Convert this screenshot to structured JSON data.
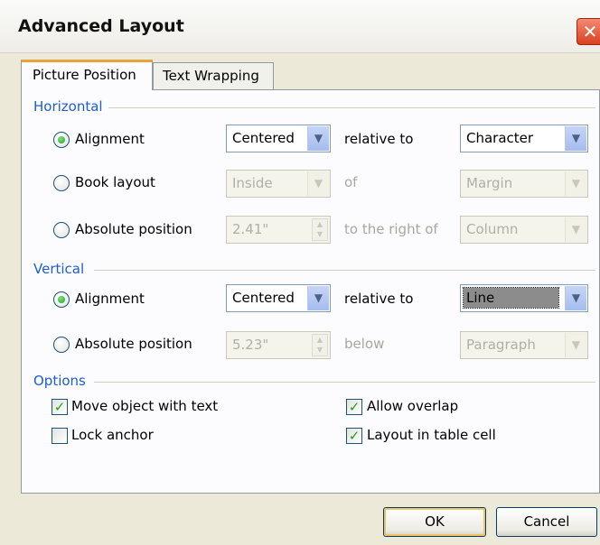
{
  "window": {
    "title": "Advanced Layout",
    "close_glyph": "✕"
  },
  "tabs": [
    {
      "label": "Picture Position",
      "active": true
    },
    {
      "label": "Text Wrapping",
      "active": false
    }
  ],
  "horizontal": {
    "section_label": "Horizontal",
    "alignment": {
      "label": "Alignment",
      "selected": true,
      "value": "Centered",
      "relation": "relative to",
      "relative_value": "Character"
    },
    "book_layout": {
      "label": "Book layout",
      "selected": false,
      "value": "Inside",
      "relation": "of",
      "relative_value": "Margin"
    },
    "absolute": {
      "label": "Absolute position",
      "selected": false,
      "value": "2.41\"",
      "relation": "to the right of",
      "relative_value": "Column"
    }
  },
  "vertical": {
    "section_label": "Vertical",
    "alignment": {
      "label": "Alignment",
      "selected": true,
      "value": "Centered",
      "relation": "relative to",
      "relative_value": "Line"
    },
    "absolute": {
      "label": "Absolute position",
      "selected": false,
      "value": "5.23\"",
      "relation": "below",
      "relative_value": "Paragraph"
    }
  },
  "options": {
    "section_label": "Options",
    "move_with_text": {
      "label": "Move object with text",
      "checked": true
    },
    "lock_anchor": {
      "label": "Lock anchor",
      "checked": false
    },
    "allow_overlap": {
      "label": "Allow overlap",
      "checked": true
    },
    "layout_in_cell": {
      "label": "Layout in table cell",
      "checked": true
    }
  },
  "buttons": {
    "ok": "OK",
    "cancel": "Cancel"
  },
  "icons": {
    "dropdown": "chevron-down-icon",
    "spin": "spin-arrows-icon",
    "check": "checkmark-icon"
  },
  "colors": {
    "section_title": "#1c5dd4",
    "dialog_bg": "#ece9d8",
    "active_tab_accent": "#e8a33d",
    "close_button": "#d9411f",
    "check_green": "#21a121"
  }
}
